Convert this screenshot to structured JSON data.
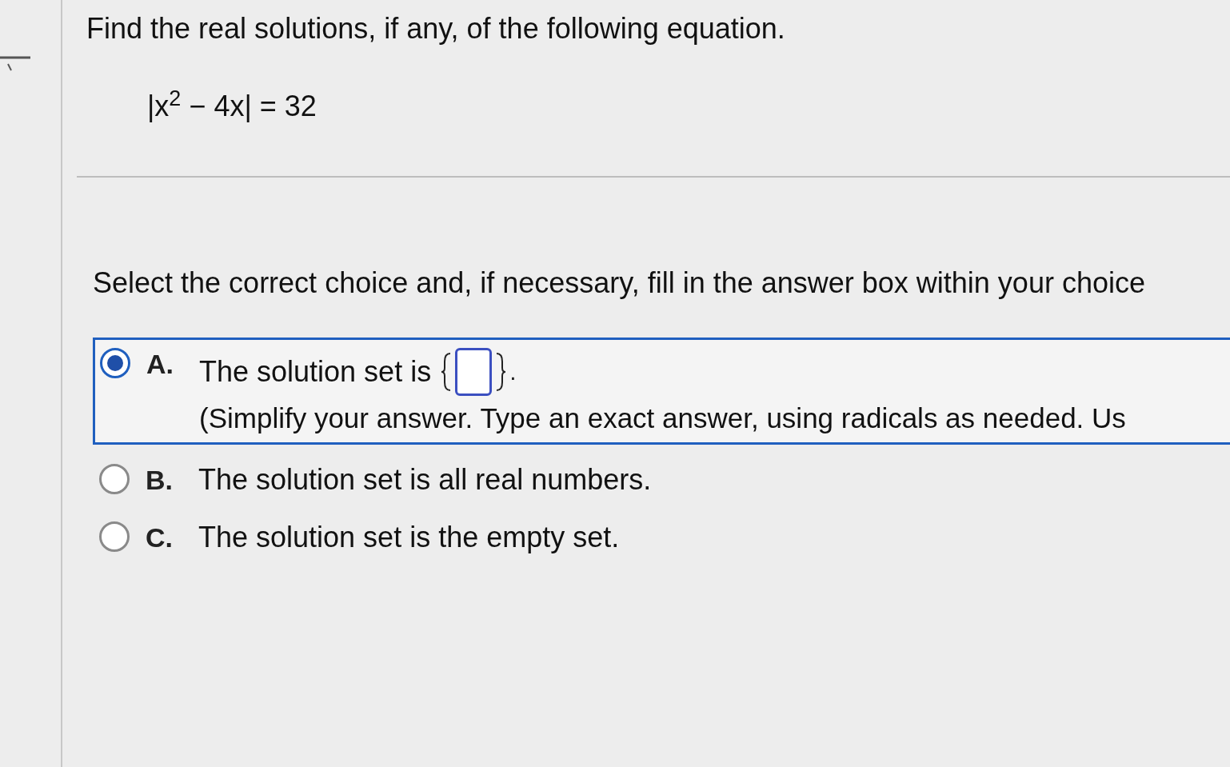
{
  "question": {
    "prompt": "Find the real solutions, if any, of the following equation.",
    "equation": "|x$^{2}$ − 4x| = 32"
  },
  "instruction": "Select the correct choice and, if necessary, fill in the answer box within your choice",
  "choices": [
    {
      "letter": "A.",
      "text": "The solution set is",
      "kind": "answer-set",
      "hint": "(Simplify your answer. Type an exact answer, using radicals as needed. Us",
      "end_mark": ".",
      "selected": true
    },
    {
      "letter": "B.",
      "text": "The solution set is all real numbers.",
      "kind": "plain",
      "selected": false
    },
    {
      "letter": "C.",
      "text": "The solution set is the empty set.",
      "kind": "plain",
      "selected": false
    }
  ]
}
